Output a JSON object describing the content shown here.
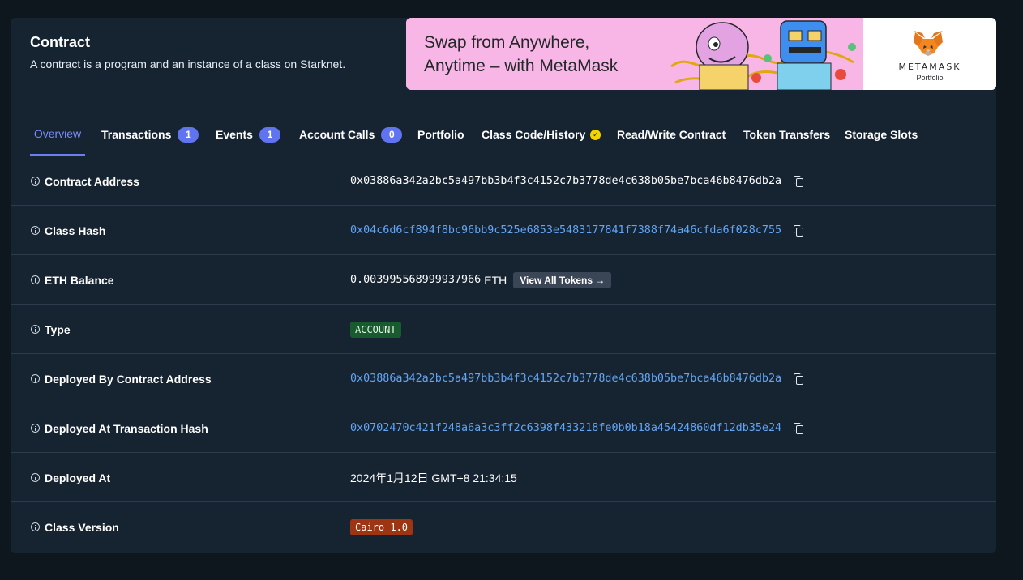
{
  "header": {
    "title": "Contract",
    "subtitle": "A contract is a program and an instance of a class on Starknet."
  },
  "banner": {
    "headline_line1": "Swap from Anywhere,",
    "headline_line2": "Anytime – with MetaMask",
    "brand": "METAMASK",
    "brand_sub": "Portfolio",
    "background_color": "#f8b6e6"
  },
  "tabs": [
    {
      "label": "Overview",
      "active": true
    },
    {
      "label": "Transactions",
      "badge": "1"
    },
    {
      "label": "Events",
      "badge": "1"
    },
    {
      "label": "Account Calls",
      "badge": "0"
    },
    {
      "label": "Portfolio"
    },
    {
      "label": "Class Code/History",
      "icon": "verified-check-icon"
    },
    {
      "label": "Read/Write Contract"
    },
    {
      "label": "Token Transfers"
    },
    {
      "label": "Storage Slots"
    }
  ],
  "details": {
    "contract_address": {
      "label": "Contract Address",
      "value": "0x03886a342a2bc5a497bb3b4f3c4152c7b3778de4c638b05be7bca46b8476db2a"
    },
    "class_hash": {
      "label": "Class Hash",
      "value": "0x04c6d6cf894f8bc96bb9c525e6853e5483177841f7388f74a46cfda6f028c755"
    },
    "eth_balance": {
      "label": "ETH Balance",
      "value": "0.003995568999937966",
      "unit": "ETH",
      "button": "View All Tokens →"
    },
    "type": {
      "label": "Type",
      "value": "ACCOUNT"
    },
    "deployed_by": {
      "label": "Deployed By Contract Address",
      "value": "0x03886a342a2bc5a497bb3b4f3c4152c7b3778de4c638b05be7bca46b8476db2a"
    },
    "deployed_tx": {
      "label": "Deployed At Transaction Hash",
      "value": "0x0702470c421f248a6a3c3ff2c6398f433218fe0b0b18a45424860df12db35e24"
    },
    "deployed_at": {
      "label": "Deployed At",
      "value": "2024年1月12日 GMT+8 21:34:15"
    },
    "class_version": {
      "label": "Class Version",
      "value": "Cairo 1.0"
    }
  },
  "colors": {
    "page_bg": "#0e161e",
    "panel_bg": "#162331",
    "accent": "#6174f0",
    "link": "#62a6f5",
    "type_tag": "#185b2e",
    "version_tag": "#9d3412"
  }
}
